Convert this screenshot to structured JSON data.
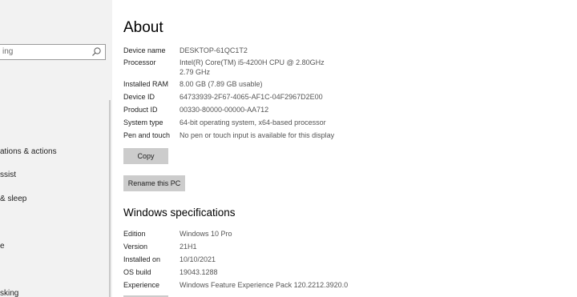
{
  "sidebar": {
    "search_text": "ing",
    "items": [
      {
        "label": "ations & actions"
      },
      {
        "label": "ssist"
      },
      {
        "label": "& sleep"
      },
      {
        "label": "e"
      },
      {
        "label": "sking"
      }
    ]
  },
  "about": {
    "title": "About",
    "fields": [
      {
        "label": "Device name",
        "value": "DESKTOP-61QC1T2"
      },
      {
        "label": "Processor",
        "value": "Intel(R) Core(TM) i5-4200H CPU @ 2.80GHz   2.79 GHz"
      },
      {
        "label": "Installed RAM",
        "value": "8.00 GB (7.89 GB usable)"
      },
      {
        "label": "Device ID",
        "value": "64733939-2F67-4065-AF1C-04F2967D2E00"
      },
      {
        "label": "Product ID",
        "value": "00330-80000-00000-AA712"
      },
      {
        "label": "System type",
        "value": "64-bit operating system, x64-based processor"
      },
      {
        "label": "Pen and touch",
        "value": "No pen or touch input is available for this display"
      }
    ],
    "copy_label": "Copy",
    "rename_label": "Rename this PC"
  },
  "windows_spec": {
    "title": "Windows specifications",
    "fields": [
      {
        "label": "Edition",
        "value": "Windows 10 Pro"
      },
      {
        "label": "Version",
        "value": "21H1"
      },
      {
        "label": "Installed on",
        "value": "10/10/2021"
      },
      {
        "label": "OS build",
        "value": "19043.1288"
      },
      {
        "label": "Experience",
        "value": "Windows Feature Experience Pack 120.2212.3920.0"
      }
    ]
  },
  "icons": {
    "search": "search-icon"
  }
}
